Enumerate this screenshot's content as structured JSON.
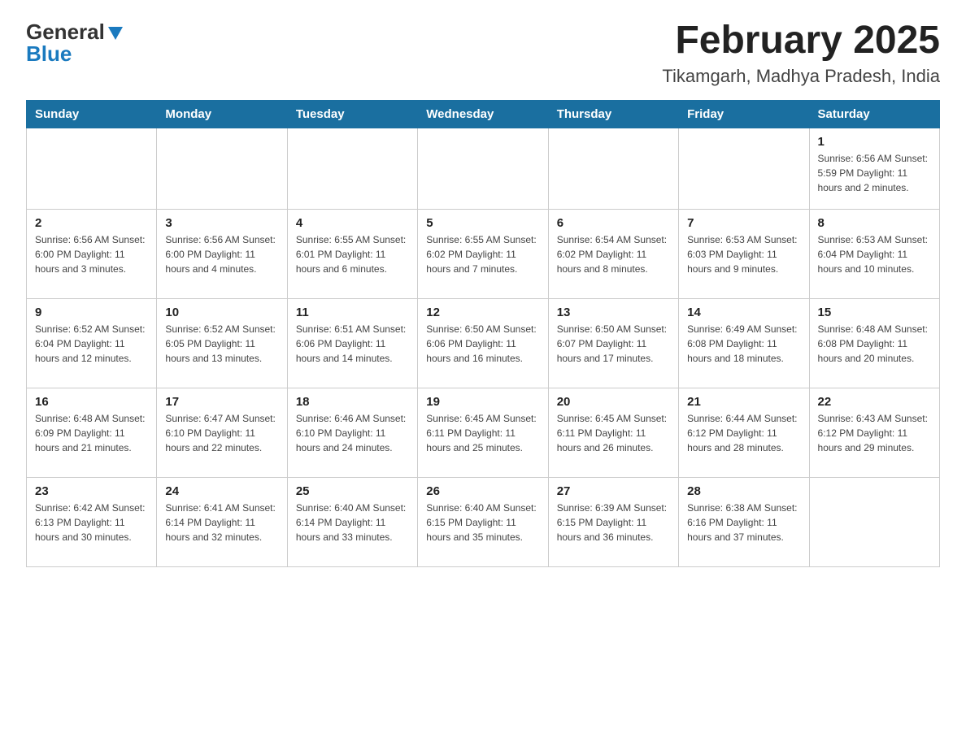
{
  "header": {
    "title": "February 2025",
    "subtitle": "Tikamgarh, Madhya Pradesh, India",
    "logo_general": "General",
    "logo_blue": "Blue"
  },
  "days_of_week": [
    "Sunday",
    "Monday",
    "Tuesday",
    "Wednesday",
    "Thursday",
    "Friday",
    "Saturday"
  ],
  "weeks": [
    {
      "days": [
        {
          "num": "",
          "info": ""
        },
        {
          "num": "",
          "info": ""
        },
        {
          "num": "",
          "info": ""
        },
        {
          "num": "",
          "info": ""
        },
        {
          "num": "",
          "info": ""
        },
        {
          "num": "",
          "info": ""
        },
        {
          "num": "1",
          "info": "Sunrise: 6:56 AM\nSunset: 5:59 PM\nDaylight: 11 hours and 2 minutes."
        }
      ]
    },
    {
      "days": [
        {
          "num": "2",
          "info": "Sunrise: 6:56 AM\nSunset: 6:00 PM\nDaylight: 11 hours and 3 minutes."
        },
        {
          "num": "3",
          "info": "Sunrise: 6:56 AM\nSunset: 6:00 PM\nDaylight: 11 hours and 4 minutes."
        },
        {
          "num": "4",
          "info": "Sunrise: 6:55 AM\nSunset: 6:01 PM\nDaylight: 11 hours and 6 minutes."
        },
        {
          "num": "5",
          "info": "Sunrise: 6:55 AM\nSunset: 6:02 PM\nDaylight: 11 hours and 7 minutes."
        },
        {
          "num": "6",
          "info": "Sunrise: 6:54 AM\nSunset: 6:02 PM\nDaylight: 11 hours and 8 minutes."
        },
        {
          "num": "7",
          "info": "Sunrise: 6:53 AM\nSunset: 6:03 PM\nDaylight: 11 hours and 9 minutes."
        },
        {
          "num": "8",
          "info": "Sunrise: 6:53 AM\nSunset: 6:04 PM\nDaylight: 11 hours and 10 minutes."
        }
      ]
    },
    {
      "days": [
        {
          "num": "9",
          "info": "Sunrise: 6:52 AM\nSunset: 6:04 PM\nDaylight: 11 hours and 12 minutes."
        },
        {
          "num": "10",
          "info": "Sunrise: 6:52 AM\nSunset: 6:05 PM\nDaylight: 11 hours and 13 minutes."
        },
        {
          "num": "11",
          "info": "Sunrise: 6:51 AM\nSunset: 6:06 PM\nDaylight: 11 hours and 14 minutes."
        },
        {
          "num": "12",
          "info": "Sunrise: 6:50 AM\nSunset: 6:06 PM\nDaylight: 11 hours and 16 minutes."
        },
        {
          "num": "13",
          "info": "Sunrise: 6:50 AM\nSunset: 6:07 PM\nDaylight: 11 hours and 17 minutes."
        },
        {
          "num": "14",
          "info": "Sunrise: 6:49 AM\nSunset: 6:08 PM\nDaylight: 11 hours and 18 minutes."
        },
        {
          "num": "15",
          "info": "Sunrise: 6:48 AM\nSunset: 6:08 PM\nDaylight: 11 hours and 20 minutes."
        }
      ]
    },
    {
      "days": [
        {
          "num": "16",
          "info": "Sunrise: 6:48 AM\nSunset: 6:09 PM\nDaylight: 11 hours and 21 minutes."
        },
        {
          "num": "17",
          "info": "Sunrise: 6:47 AM\nSunset: 6:10 PM\nDaylight: 11 hours and 22 minutes."
        },
        {
          "num": "18",
          "info": "Sunrise: 6:46 AM\nSunset: 6:10 PM\nDaylight: 11 hours and 24 minutes."
        },
        {
          "num": "19",
          "info": "Sunrise: 6:45 AM\nSunset: 6:11 PM\nDaylight: 11 hours and 25 minutes."
        },
        {
          "num": "20",
          "info": "Sunrise: 6:45 AM\nSunset: 6:11 PM\nDaylight: 11 hours and 26 minutes."
        },
        {
          "num": "21",
          "info": "Sunrise: 6:44 AM\nSunset: 6:12 PM\nDaylight: 11 hours and 28 minutes."
        },
        {
          "num": "22",
          "info": "Sunrise: 6:43 AM\nSunset: 6:12 PM\nDaylight: 11 hours and 29 minutes."
        }
      ]
    },
    {
      "days": [
        {
          "num": "23",
          "info": "Sunrise: 6:42 AM\nSunset: 6:13 PM\nDaylight: 11 hours and 30 minutes."
        },
        {
          "num": "24",
          "info": "Sunrise: 6:41 AM\nSunset: 6:14 PM\nDaylight: 11 hours and 32 minutes."
        },
        {
          "num": "25",
          "info": "Sunrise: 6:40 AM\nSunset: 6:14 PM\nDaylight: 11 hours and 33 minutes."
        },
        {
          "num": "26",
          "info": "Sunrise: 6:40 AM\nSunset: 6:15 PM\nDaylight: 11 hours and 35 minutes."
        },
        {
          "num": "27",
          "info": "Sunrise: 6:39 AM\nSunset: 6:15 PM\nDaylight: 11 hours and 36 minutes."
        },
        {
          "num": "28",
          "info": "Sunrise: 6:38 AM\nSunset: 6:16 PM\nDaylight: 11 hours and 37 minutes."
        },
        {
          "num": "",
          "info": ""
        }
      ]
    }
  ]
}
